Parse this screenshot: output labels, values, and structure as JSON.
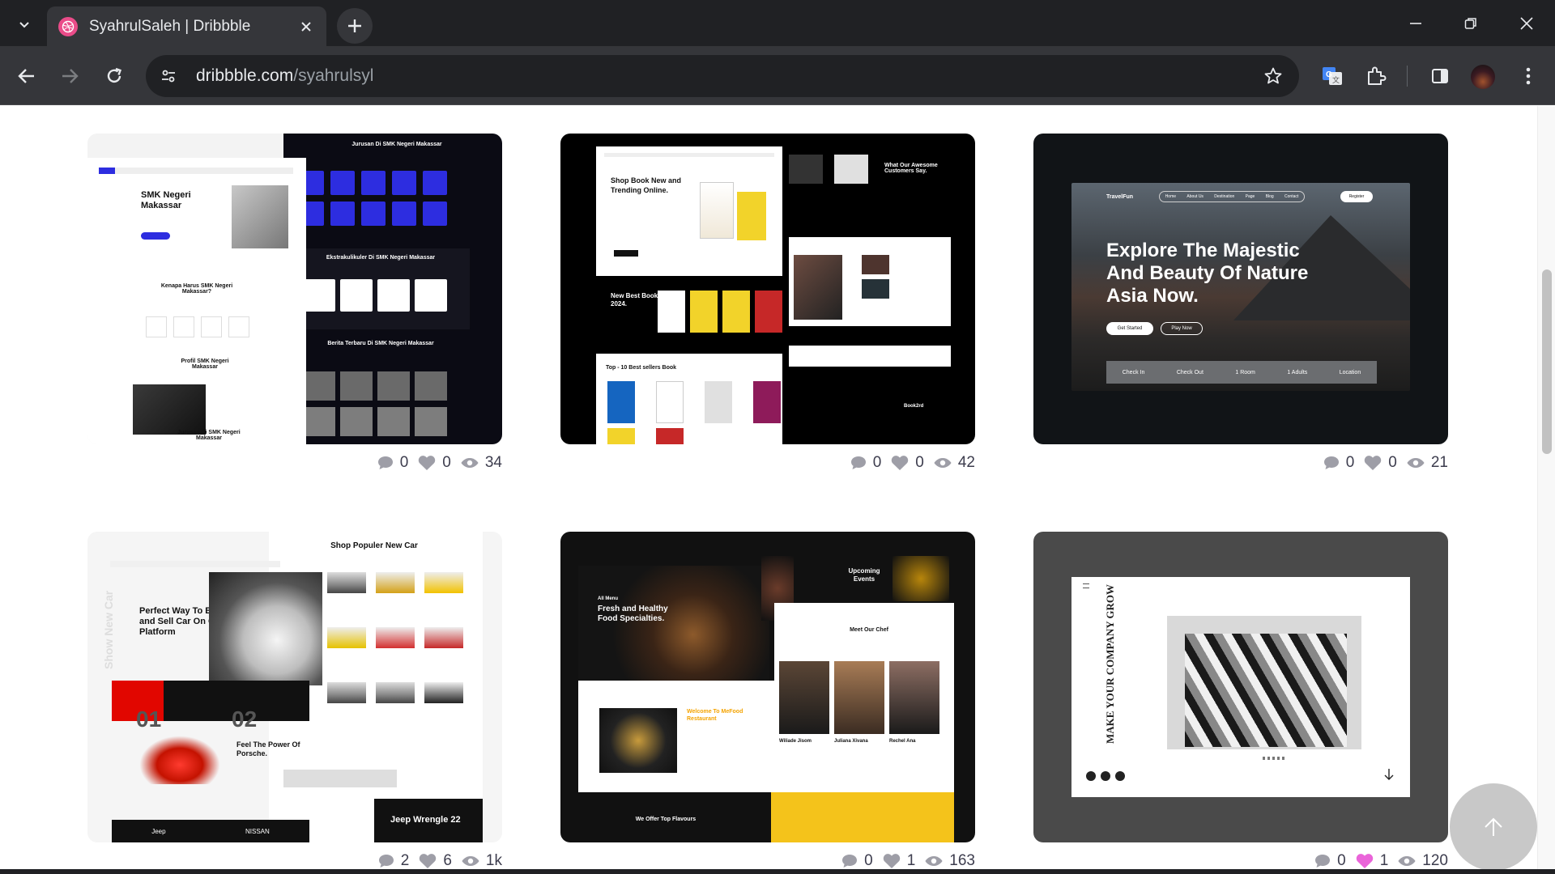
{
  "browser": {
    "tab_title": "SyahrulSaleh | Dribbble",
    "url_domain": "dribbble.com",
    "url_path": "/syahrulsyl"
  },
  "shots": [
    {
      "id": "smk",
      "texts": {
        "hero": "SMK Negeri Makassar",
        "section1": "Kenapa Harus SMK Negeri Makassar?",
        "section2": "Profil SMK Negeri Makassar",
        "section3": "Jurusan Di SMK Negeri Makassar",
        "right1": "Jurusan Di SMK Negeri Makassar",
        "right2": "Ekstrakulikuler Di SMK Negeri Makassar",
        "right3": "Berita Terbaru Di SMK Negeri Makassar"
      },
      "stats": {
        "comments": "0",
        "likes": "0",
        "views": "34"
      },
      "liked": false
    },
    {
      "id": "bookstore",
      "texts": {
        "hero": "Shop Book New and Trending Online.",
        "new_best": "New Best Book 2024.",
        "top10": "Top - 10 Best sellers Book",
        "testimonial": "What Our Awesome Customers Say.",
        "brand": "Book2rd"
      },
      "stats": {
        "comments": "0",
        "likes": "0",
        "views": "42"
      },
      "liked": false
    },
    {
      "id": "travel",
      "texts": {
        "brand": "TravelFun",
        "headline": "Explore The Majestic And Beauty Of Nature Asia Now.",
        "get_started": "Get Started",
        "play": "Play Now",
        "register": "Register",
        "nav": [
          "Home",
          "About Us",
          "Destination",
          "Page",
          "Blog",
          "Contact"
        ],
        "search_bar": [
          "Check In",
          "Check Out",
          "1 Room",
          "1 Adults",
          "Location"
        ]
      },
      "stats": {
        "comments": "0",
        "likes": "0",
        "views": "21"
      },
      "liked": false
    },
    {
      "id": "cars",
      "texts": {
        "top_title": "Shop Populer New Car",
        "hero": "Perfect Way To Buy and Sell Car On Our Platform",
        "porsche": "Feel The Power Of Porsche.",
        "jeep": "Jeep Wrengle 22",
        "side": "Show New Car",
        "num1": "01",
        "num2": "02",
        "brands": [
          "Jeep",
          "NISSAN"
        ]
      },
      "stats": {
        "comments": "2",
        "likes": "6",
        "views": "1k"
      },
      "liked": false
    },
    {
      "id": "food",
      "texts": {
        "hero_kicker": "All Menu",
        "hero": "Fresh and Healthy Food Specialties.",
        "upcoming": "Upcoming Events",
        "chef_title": "Meet Our Chef",
        "welcome": "Welcome To MeFood Restaurant",
        "offer": "We Offer Top Flavours",
        "chefs": [
          "Wiliade Jisom",
          "Juliana Xivana",
          "Rechel Ana"
        ]
      },
      "stats": {
        "comments": "0",
        "likes": "1",
        "views": "163"
      },
      "liked": false
    },
    {
      "id": "architecture",
      "texts": {
        "vertical": "MAKE YOUR COMPANY GROW"
      },
      "stats": {
        "comments": "0",
        "likes": "1",
        "views": "120"
      },
      "liked": true
    }
  ],
  "colors": {
    "dribbble_pink": "#ea4c89",
    "stat_gray": "#3d3d4e",
    "icon_gray": "#9e9ea7",
    "liked_pink": "#ea64d9"
  }
}
